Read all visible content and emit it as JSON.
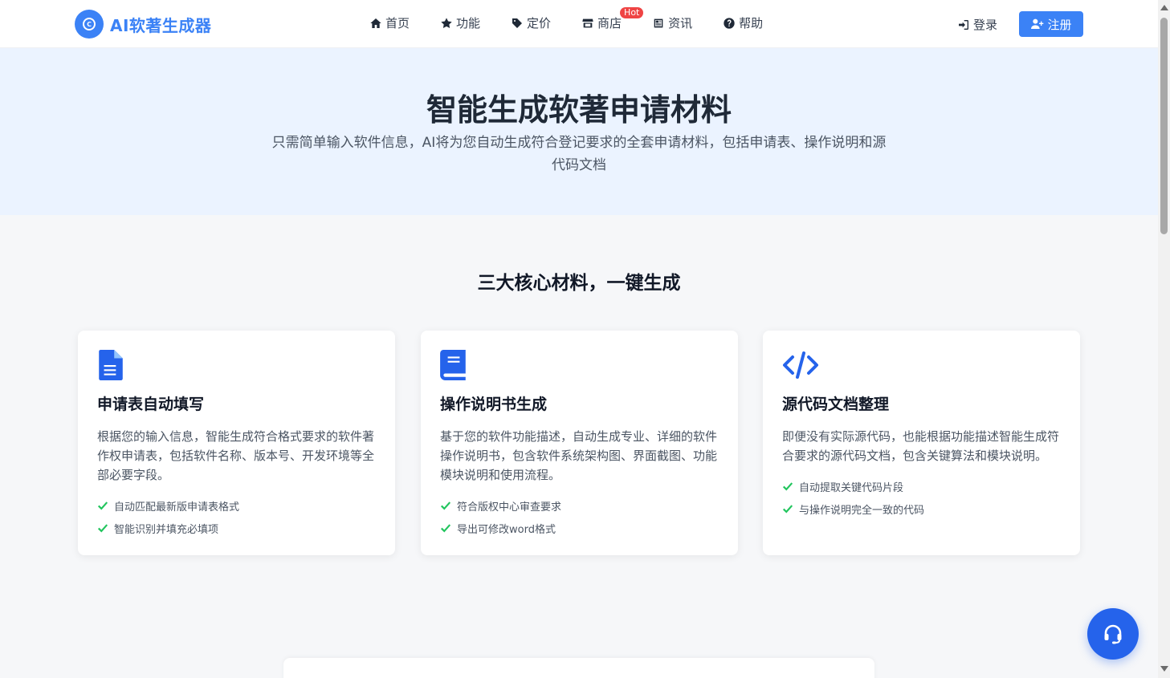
{
  "header": {
    "logo_text": "AI软著生成器",
    "nav": [
      {
        "label": "首页",
        "icon": "home-icon"
      },
      {
        "label": "功能",
        "icon": "star-icon"
      },
      {
        "label": "定价",
        "icon": "tag-icon"
      },
      {
        "label": "商店",
        "icon": "store-icon",
        "badge": "Hot"
      },
      {
        "label": "资讯",
        "icon": "newspaper-icon"
      },
      {
        "label": "帮助",
        "icon": "help-icon"
      }
    ],
    "login_label": "登录",
    "register_label": "注册"
  },
  "hero": {
    "title": "智能生成软著申请材料",
    "subtitle": "只需简单输入软件信息，AI将为您自动生成符合登记要求的全套申请材料，包括申请表、操作说明和源代码文档"
  },
  "section": {
    "title": "三大核心材料，一键生成"
  },
  "cards": [
    {
      "icon": "document-icon",
      "title": "申请表自动填写",
      "description": "根据您的输入信息，智能生成符合格式要求的软件著作权申请表，包括软件名称、版本号、开发环境等全部必要字段。",
      "features": [
        "自动匹配最新版申请表格式",
        "智能识别并填充必填项"
      ]
    },
    {
      "icon": "book-icon",
      "title": "操作说明书生成",
      "description": "基于您的软件功能描述，自动生成专业、详细的软件操作说明书，包含软件系统架构图、界面截图、功能模块说明和使用流程。",
      "features": [
        "符合版权中心审查要求",
        "导出可修改word格式"
      ]
    },
    {
      "icon": "code-icon",
      "title": "源代码文档整理",
      "description": "即便没有实际源代码，也能根据功能描述智能生成符合要求的源代码文档，包含关键算法和模块说明。",
      "features": [
        "自动提取关键代码片段",
        "与操作说明完全一致的代码"
      ]
    }
  ],
  "colors": {
    "primary": "#3b82f6",
    "hero_bg": "#ebf3ff",
    "check": "#22c55e",
    "badge": "#ef4444"
  }
}
